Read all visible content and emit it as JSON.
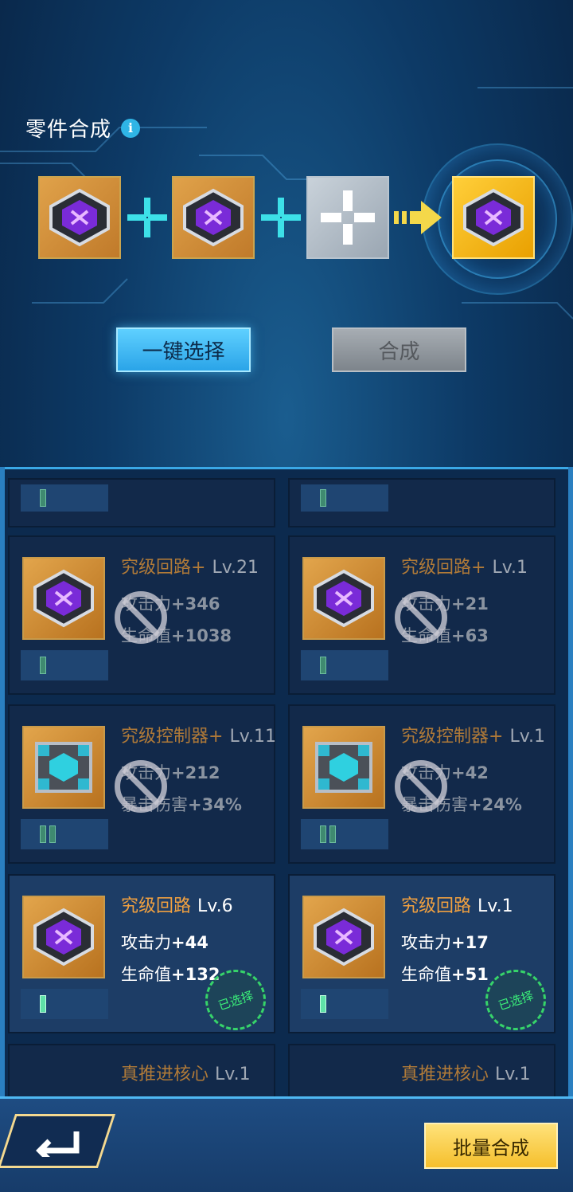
{
  "header": {
    "title": "零件合成"
  },
  "synth_slots": [
    {
      "state": "filled",
      "item": "circuit-chip"
    },
    {
      "state": "filled",
      "item": "circuit-chip"
    },
    {
      "state": "empty",
      "item": "plus-placeholder"
    },
    {
      "state": "result",
      "item": "circuit-chip"
    }
  ],
  "buttons": {
    "auto_select": "一键选择",
    "compose": "合成",
    "batch_compose": "批量合成"
  },
  "cards": [
    {
      "name": "究级回路+",
      "lv": "Lv.21",
      "stat1_label": "攻击力",
      "stat1_value": "+346",
      "stat2_label": "生命值",
      "stat2_value": "+1038",
      "pips": 1,
      "state": "blocked",
      "icon": "circuit-chip"
    },
    {
      "name": "究级回路+",
      "lv": "Lv.1",
      "stat1_label": "攻击力",
      "stat1_value": "+21",
      "stat2_label": "生命值",
      "stat2_value": "+63",
      "pips": 1,
      "state": "blocked",
      "icon": "circuit-chip"
    },
    {
      "name": "究级控制器+",
      "lv": "Lv.11",
      "stat1_label": "攻击力",
      "stat1_value": "+212",
      "stat2_label": "暴击伤害",
      "stat2_value": "+34%",
      "pips": 2,
      "state": "blocked",
      "icon": "controller"
    },
    {
      "name": "究级控制器+",
      "lv": "Lv.1",
      "stat1_label": "攻击力",
      "stat1_value": "+42",
      "stat2_label": "暴击伤害",
      "stat2_value": "+24%",
      "pips": 2,
      "state": "blocked",
      "icon": "controller"
    },
    {
      "name": "究级回路",
      "lv": "Lv.6",
      "stat1_label": "攻击力",
      "stat1_value": "+44",
      "stat2_label": "生命值",
      "stat2_value": "+132",
      "pips": 1,
      "state": "selected",
      "badge": "已选择",
      "icon": "circuit-chip"
    },
    {
      "name": "究级回路",
      "lv": "Lv.1",
      "stat1_label": "攻击力",
      "stat1_value": "+17",
      "stat2_label": "生命值",
      "stat2_value": "+51",
      "pips": 1,
      "state": "selected",
      "badge": "已选择",
      "icon": "circuit-chip"
    },
    {
      "name": "真推进核心",
      "lv": "Lv.1",
      "state": "partial",
      "icon": "thruster-core"
    },
    {
      "name": "真推进核心",
      "lv": "Lv.1",
      "state": "partial",
      "icon": "thruster-core"
    }
  ]
}
